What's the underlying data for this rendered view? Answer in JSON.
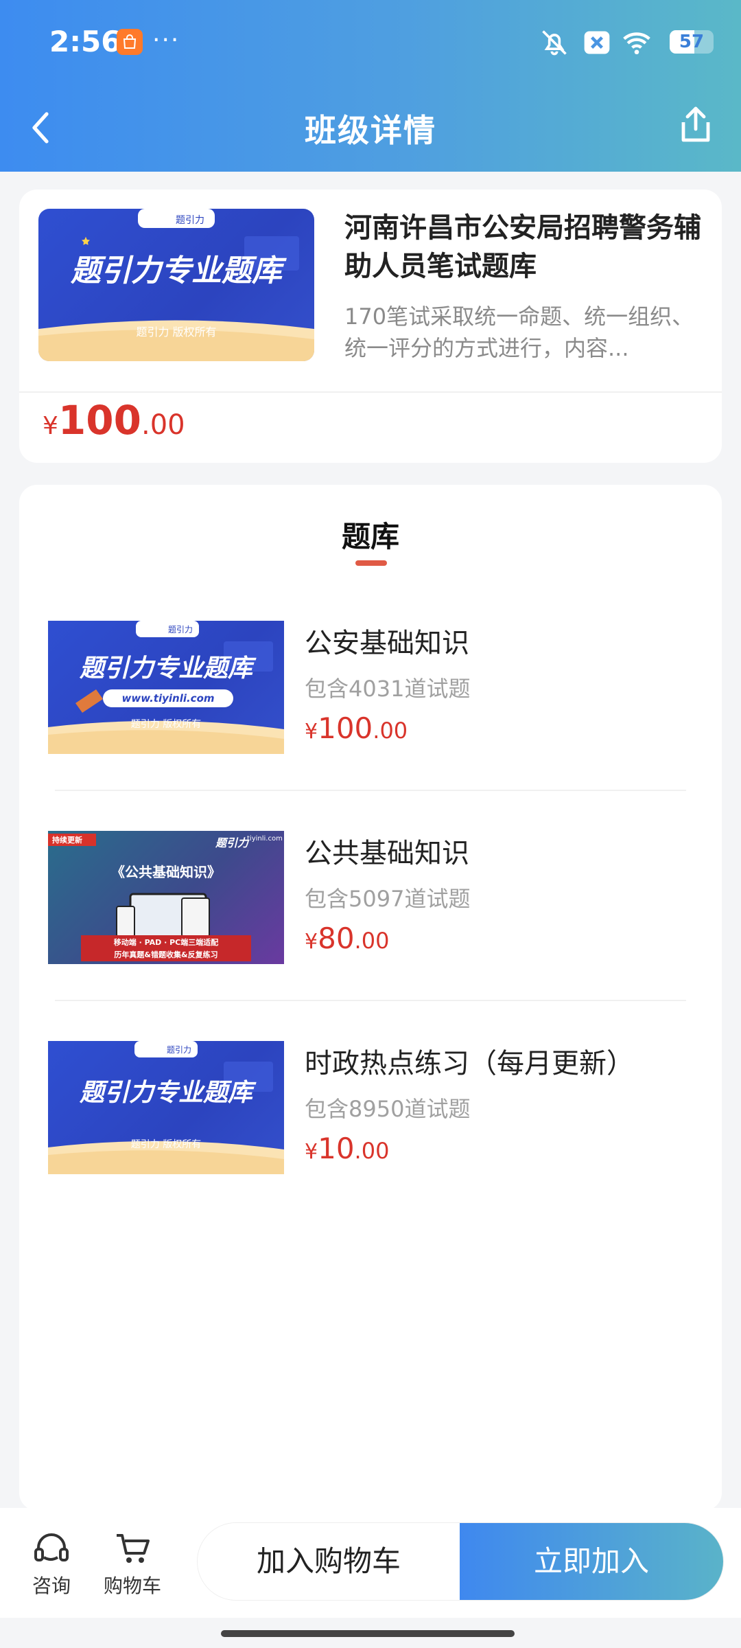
{
  "status_bar": {
    "time": "2:56",
    "dots": "···",
    "battery": "57",
    "battery_level": 0.57
  },
  "nav": {
    "title": "班级详情"
  },
  "course": {
    "cover_title": "题引力专业题库",
    "cover_brand": "题引力",
    "cover_footer": "题引力 版权所有",
    "title": "河南许昌市公安局招聘警务辅助人员笔试题库",
    "desc": "170笔试采取统一命题、统一组织、统一评分的方式进行，内容...",
    "price_symbol": "¥",
    "price_int": "100",
    "price_dec": ".00"
  },
  "section": {
    "title": "题库"
  },
  "banks": [
    {
      "cover_title": "题引力专业题库",
      "cover_brand": "题引力",
      "cover_url": "www.tiyinli.com",
      "cover_footer": "题引力 版权所有",
      "name": "公安基础知识",
      "count": "包含4031道试题",
      "price_symbol": "¥",
      "price_int": "100",
      "price_dec": ".00"
    },
    {
      "cover_badge": "持续更新",
      "cover_logo": "题引力",
      "cover_site": "tiyinli.com",
      "cover_title": "《公共基础知识》",
      "cover_line1": "移动端 · PAD · PC端三端适配",
      "cover_line2": "历年真题&错题收集&反复练习",
      "name": "公共基础知识",
      "count": "包含5097道试题",
      "price_symbol": "¥",
      "price_int": "80",
      "price_dec": ".00"
    },
    {
      "cover_title": "题引力专业题库",
      "cover_brand": "题引力",
      "cover_footer": "题引力 版权所有",
      "name": "时政热点练习（每月更新）",
      "count": "包含8950道试题",
      "price_symbol": "¥",
      "price_int": "10",
      "price_dec": ".00"
    }
  ],
  "bottom": {
    "consult_label": "咨询",
    "cart_label": "购物车",
    "add_cart": "加入购物车",
    "join": "立即加入"
  }
}
